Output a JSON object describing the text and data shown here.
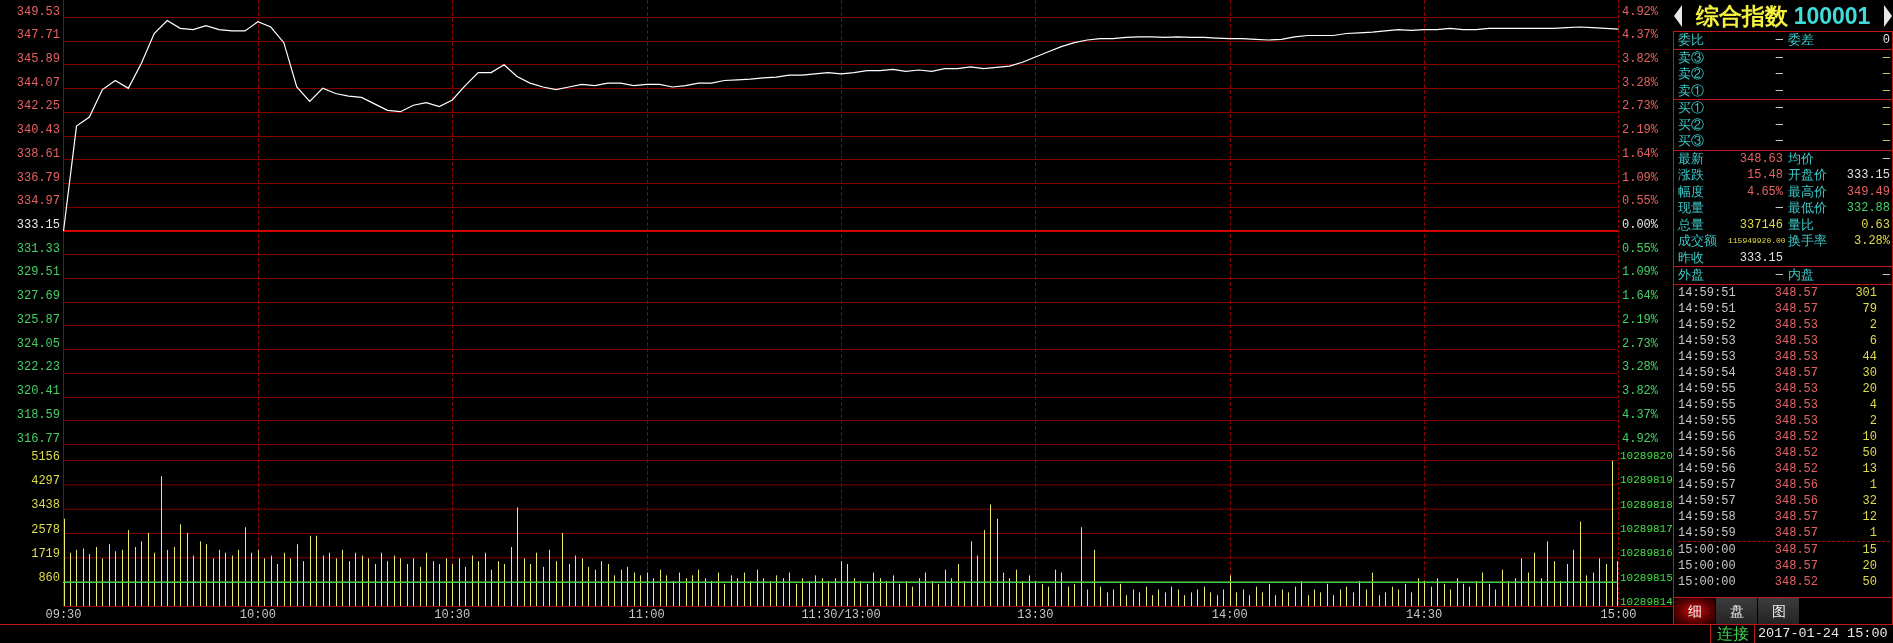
{
  "price_chart": {
    "chart_data": {
      "type": "line",
      "grid": true,
      "ylim": [
        316.77,
        349.53
      ],
      "yticks": [
        316.77,
        318.59,
        320.41,
        322.23,
        324.05,
        325.87,
        327.69,
        329.51,
        331.33,
        333.15,
        334.97,
        336.79,
        338.61,
        340.43,
        342.25,
        344.07,
        345.89,
        347.71,
        349.53
      ],
      "series": [
        {
          "color": "#ffffff",
          "values": [
            333.15,
            341.2,
            341.9,
            344.0,
            344.7,
            344.1,
            346.0,
            348.3,
            349.3,
            348.7,
            348.6,
            348.9,
            348.6,
            348.5,
            348.5,
            349.2,
            348.8,
            347.6,
            344.2,
            343.1,
            344.1,
            343.7,
            343.5,
            343.4,
            342.9,
            342.4,
            342.3,
            342.8,
            343.0,
            342.7,
            343.2,
            344.3,
            345.3,
            345.3,
            345.9,
            345.0,
            344.5,
            344.2,
            344.0,
            344.2,
            344.4,
            344.3,
            344.5,
            344.5,
            344.3,
            344.4,
            344.4,
            344.2,
            344.3,
            344.5,
            344.5,
            344.7,
            344.75,
            344.8,
            344.9,
            344.95,
            345.1,
            345.1,
            345.2,
            345.3,
            345.2,
            345.3,
            345.45,
            345.45,
            345.55,
            345.4,
            345.5,
            345.4,
            345.6,
            345.6,
            345.75,
            345.6,
            345.7,
            345.8,
            346.1,
            346.5,
            346.9,
            347.3,
            347.6,
            347.8,
            347.9,
            347.9,
            348.0,
            348.05,
            348.05,
            348.0,
            348.05,
            348.0,
            348.0,
            347.95,
            347.9,
            347.9,
            347.85,
            347.8,
            347.85,
            348.05,
            348.15,
            348.15,
            348.15,
            348.3,
            348.35,
            348.4,
            348.5,
            348.6,
            348.55,
            348.6,
            348.6,
            348.7,
            348.6,
            348.6,
            348.7,
            348.7,
            348.7,
            348.7,
            348.7,
            348.7,
            348.75,
            348.8,
            348.75,
            348.7,
            348.63
          ]
        }
      ],
      "ref_lines": [
        {
          "axis": "y",
          "value": 333.15,
          "color": "#d00000"
        }
      ]
    },
    "percent_axis": [
      "4.92%",
      "4.37%",
      "3.82%",
      "3.28%",
      "2.73%",
      "2.19%",
      "1.64%",
      "1.09%",
      "0.55%",
      "0.00%",
      "0.55%",
      "1.09%",
      "1.64%",
      "2.19%",
      "2.73%",
      "3.28%",
      "3.82%",
      "4.37%",
      "4.92%"
    ]
  },
  "volume_chart": {
    "chart_data": {
      "type": "bar",
      "grid": true,
      "ylim": [
        0,
        5156
      ],
      "yticks": [
        860,
        1719,
        2578,
        3438,
        4297,
        5156
      ],
      "categories": [
        "09:30",
        null,
        null,
        null,
        null,
        null,
        null,
        null,
        null,
        null,
        null,
        null,
        null,
        null,
        null,
        null,
        null,
        null,
        null,
        null,
        null,
        null,
        null,
        null,
        null,
        null,
        null,
        null,
        null,
        null,
        "10:00",
        null,
        null,
        null,
        null,
        null,
        null,
        null,
        null,
        null,
        null,
        null,
        null,
        null,
        null,
        null,
        null,
        null,
        null,
        null,
        null,
        null,
        null,
        null,
        null,
        null,
        null,
        null,
        null,
        null,
        "10:30",
        null,
        null,
        null,
        null,
        null,
        null,
        null,
        null,
        null,
        null,
        null,
        null,
        null,
        null,
        null,
        null,
        null,
        null,
        null,
        null,
        null,
        null,
        null,
        null,
        null,
        null,
        null,
        null,
        null,
        "11:00",
        null,
        null,
        null,
        null,
        null,
        null,
        null,
        null,
        null,
        null,
        null,
        null,
        null,
        null,
        null,
        null,
        null,
        null,
        null,
        null,
        null,
        null,
        null,
        null,
        null,
        null,
        null,
        null,
        null,
        "11:30/13:00",
        null,
        null,
        null,
        null,
        null,
        null,
        null,
        null,
        null,
        null,
        null,
        null,
        null,
        null,
        null,
        null,
        null,
        null,
        null,
        null,
        null,
        null,
        null,
        null,
        null,
        null,
        null,
        null,
        null,
        "13:30",
        null,
        null,
        null,
        null,
        null,
        null,
        null,
        null,
        null,
        null,
        null,
        null,
        null,
        null,
        null,
        null,
        null,
        null,
        null,
        null,
        null,
        null,
        null,
        null,
        null,
        null,
        null,
        null,
        null,
        "14:00",
        null,
        null,
        null,
        null,
        null,
        null,
        null,
        null,
        null,
        null,
        null,
        null,
        null,
        null,
        null,
        null,
        null,
        null,
        null,
        null,
        null,
        null,
        null,
        null,
        null,
        null,
        null,
        null,
        null,
        "14:30",
        null,
        null,
        null,
        null,
        null,
        null,
        null,
        null,
        null,
        null,
        null,
        null,
        null,
        null,
        null,
        null,
        null,
        null,
        null,
        null,
        null,
        null,
        null,
        null,
        null,
        null,
        null,
        null,
        null,
        "15:00"
      ],
      "series": [
        {
          "color": "#eeea6a",
          "values": [
            3100,
            1900,
            2000,
            2050,
            1850,
            2100,
            1700,
            2200,
            1950,
            2000,
            2700,
            2100,
            2300,
            2600,
            1900,
            4600,
            2000,
            2100,
            2900,
            2600,
            1800,
            2300,
            2200,
            1700,
            2000,
            1900,
            1800,
            2000,
            2800,
            1900,
            2000,
            1700,
            1800,
            1500,
            1900,
            1700,
            2200,
            1600,
            2500,
            2500,
            1800,
            1900,
            1700,
            2000,
            1600,
            1900,
            1800,
            1700,
            1500,
            1900,
            1600,
            1800,
            1700,
            1500,
            1700,
            1400,
            1900,
            1600,
            1500,
            1700,
            1500,
            1700,
            1400,
            1800,
            1600,
            1900,
            1300,
            1600,
            1500,
            2100,
            3500,
            1700,
            1500,
            1900,
            1400,
            2000,
            1600,
            2600,
            1500,
            1800,
            1700,
            1400,
            1300,
            1600,
            1500,
            1100,
            1300,
            1400,
            1200,
            1100,
            1200,
            1000,
            1300,
            1100,
            900,
            1200,
            1000,
            1100,
            1300,
            1000,
            900,
            1200,
            800,
            1100,
            1000,
            1200,
            900,
            1300,
            1000,
            900,
            1100,
            1000,
            1200,
            800,
            1000,
            900,
            1100,
            1000,
            900,
            1000,
            1600,
            1500,
            1000,
            900,
            800,
            1200,
            1000,
            900,
            1100,
            800,
            900,
            700,
            1000,
            1200,
            900,
            800,
            1300,
            1000,
            1500,
            900,
            2300,
            1800,
            2700,
            3600,
            3100,
            1200,
            1000,
            1300,
            900,
            1100,
            900,
            800,
            700,
            1300,
            1200,
            700,
            800,
            2800,
            600,
            2000,
            700,
            500,
            600,
            800,
            400,
            600,
            500,
            700,
            400,
            600,
            500,
            700,
            600,
            400,
            500,
            600,
            700,
            500,
            400,
            600,
            1100,
            500,
            600,
            400,
            700,
            500,
            800,
            400,
            600,
            500,
            700,
            900,
            400,
            600,
            500,
            800,
            400,
            600,
            700,
            500,
            900,
            600,
            1200,
            400,
            500,
            700,
            600,
            800,
            500,
            1000,
            900,
            700,
            1000,
            800,
            600,
            1000,
            800,
            700,
            900,
            1200,
            800,
            600,
            1300,
            900,
            1000,
            1700,
            1200,
            1900,
            1000,
            2300,
            1600,
            900,
            1500,
            2000,
            3000,
            1100,
            1200,
            1700,
            1500,
            5150,
            1600
          ]
        }
      ],
      "ref_lines": [
        {
          "axis": "y",
          "value": 860,
          "color": "#3fd04a"
        }
      ]
    },
    "right_axis": [
      "10289820",
      "10289819",
      "10289818",
      "10289817",
      "10289816",
      "10289815",
      "10289814"
    ]
  },
  "quote": {
    "title": {
      "name": "综合指数",
      "code": "100001"
    },
    "sections": [
      {
        "rows": [
          {
            "cells": [
              {
                "label": "委比",
                "value": "—",
                "kind": "flat"
              },
              {
                "label": "委差",
                "value": "0",
                "kind": "flat"
              }
            ]
          }
        ]
      },
      {
        "rows": [
          {
            "cells": [
              {
                "label": "卖③",
                "value": "—",
                "kind": "flat"
              },
              {
                "value": "—",
                "kind": "amount"
              }
            ]
          },
          {
            "cells": [
              {
                "label": "卖②",
                "value": "—",
                "kind": "flat"
              },
              {
                "value": "—",
                "kind": "amount"
              }
            ]
          },
          {
            "cells": [
              {
                "label": "卖①",
                "value": "—",
                "kind": "flat"
              },
              {
                "value": "—",
                "kind": "amount"
              }
            ]
          }
        ]
      },
      {
        "rows": [
          {
            "cells": [
              {
                "label": "买①",
                "value": "—",
                "kind": "flat"
              },
              {
                "value": "—",
                "kind": "amount"
              }
            ]
          },
          {
            "cells": [
              {
                "label": "买②",
                "value": "—",
                "kind": "flat"
              },
              {
                "value": "—",
                "kind": "amount"
              }
            ]
          },
          {
            "cells": [
              {
                "label": "买③",
                "value": "—",
                "kind": "flat"
              },
              {
                "value": "—",
                "kind": "amount"
              }
            ]
          }
        ]
      },
      {
        "rows": [
          {
            "cells": [
              {
                "label": "最新",
                "value": "348.63",
                "kind": "rise"
              },
              {
                "label": "均价",
                "value": "—",
                "kind": "flat"
              }
            ]
          },
          {
            "cells": [
              {
                "label": "涨跌",
                "value": "15.48",
                "kind": "rise"
              },
              {
                "label": "开盘价",
                "value": "333.15",
                "kind": "flat"
              }
            ]
          },
          {
            "cells": [
              {
                "label": "幅度",
                "value": "4.65%",
                "kind": "rise"
              },
              {
                "label": "最高价",
                "value": "349.49",
                "kind": "rise"
              }
            ]
          },
          {
            "cells": [
              {
                "label": "现量",
                "value": "—",
                "kind": "flat"
              },
              {
                "label": "最低价",
                "value": "332.88",
                "kind": "fall"
              }
            ]
          },
          {
            "cells": [
              {
                "label": "总量",
                "value": "337146",
                "kind": "amount"
              },
              {
                "label": "量比",
                "value": "0.63",
                "kind": "amount"
              }
            ]
          },
          {
            "cells": [
              {
                "label": "成交额",
                "value": "115949920.00",
                "kind": "amount"
              },
              {
                "label": "换手率",
                "value": "3.28%",
                "kind": "amount"
              }
            ]
          },
          {
            "cells": [
              {
                "label": "昨收",
                "value": "333.15",
                "kind": "flat"
              }
            ]
          }
        ]
      },
      {
        "rows": [
          {
            "cells": [
              {
                "label": "外盘",
                "value": "—",
                "kind": "flat"
              },
              {
                "label": "内盘",
                "value": "—",
                "kind": "flat"
              }
            ]
          }
        ]
      }
    ]
  },
  "trades": {
    "session": [
      {
        "time": "14:59:51",
        "price": "348.57",
        "volume": "301"
      },
      {
        "time": "14:59:51",
        "price": "348.57",
        "volume": "79"
      },
      {
        "time": "14:59:52",
        "price": "348.53",
        "volume": "2"
      },
      {
        "time": "14:59:53",
        "price": "348.53",
        "volume": "6"
      },
      {
        "time": "14:59:53",
        "price": "348.53",
        "volume": "44"
      },
      {
        "time": "14:59:54",
        "price": "348.57",
        "volume": "30"
      },
      {
        "time": "14:59:55",
        "price": "348.53",
        "volume": "20"
      },
      {
        "time": "14:59:55",
        "price": "348.53",
        "volume": "4"
      },
      {
        "time": "14:59:55",
        "price": "348.53",
        "volume": "2"
      },
      {
        "time": "14:59:56",
        "price": "348.52",
        "volume": "10"
      },
      {
        "time": "14:59:56",
        "price": "348.52",
        "volume": "50"
      },
      {
        "time": "14:59:56",
        "price": "348.52",
        "volume": "13"
      },
      {
        "time": "14:59:57",
        "price": "348.56",
        "volume": "1"
      },
      {
        "time": "14:59:57",
        "price": "348.56",
        "volume": "32"
      },
      {
        "time": "14:59:58",
        "price": "348.57",
        "volume": "12"
      },
      {
        "time": "14:59:59",
        "price": "348.57",
        "volume": "1"
      }
    ],
    "closing": [
      {
        "time": "15:00:00",
        "price": "348.57",
        "volume": "15"
      },
      {
        "time": "15:00:00",
        "price": "348.57",
        "volume": "20"
      },
      {
        "time": "15:00:00",
        "price": "348.52",
        "volume": "50"
      }
    ]
  },
  "tabs": [
    {
      "label": "细",
      "selected": true
    },
    {
      "label": "盘",
      "selected": false
    },
    {
      "label": "图",
      "selected": false
    }
  ],
  "status_bar": {
    "connection": "连接",
    "datetime": "2017-01-24 15:00"
  }
}
